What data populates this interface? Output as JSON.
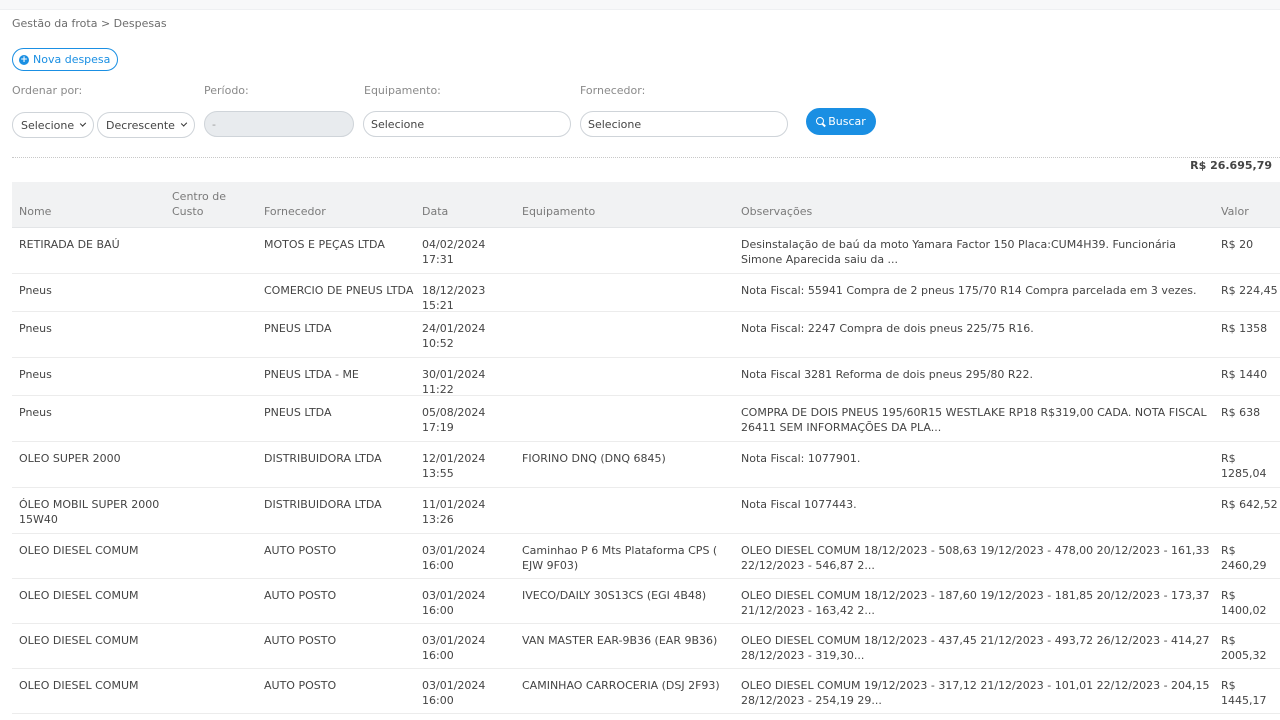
{
  "breadcrumb": "Gestão da frota > Despesas",
  "new_button_label": "Nova despesa",
  "filters": {
    "order_label": "Ordenar por:",
    "period_label": "Período:",
    "equipment_label": "Equipamento:",
    "supplier_label": "Fornecedor:",
    "order_value": "Selecione",
    "direction_value": "Decrescente",
    "period_value": "-",
    "equipment_value": "Selecione",
    "supplier_value": "Selecione",
    "search_label": "Buscar"
  },
  "total": "R$ 26.695,79",
  "columns": [
    "Nome",
    "Centro de Custo",
    "Fornecedor",
    "Data",
    "Equipamento",
    "Observações",
    "Valor"
  ],
  "rows": [
    {
      "nome": "RETIRADA DE BAÚ",
      "centro": "",
      "fornecedor": "MOTOS E PEÇAS LTDA",
      "data": "04/02/2024 17:31",
      "equipamento": "",
      "observacoes": "Desinstalação de baú da moto Yamara Factor 150 Placa:CUM4H39. Funcionária Simone Aparecida saiu da ...",
      "valor": "R$ 20"
    },
    {
      "nome": "Pneus",
      "centro": "",
      "fornecedor": "COMERCIO DE PNEUS LTDA",
      "data": "18/12/2023 15:21",
      "equipamento": "",
      "observacoes": "Nota Fiscal: 55941 Compra de 2 pneus 175/70 R14 Compra parcelada em 3 vezes.",
      "valor": "R$ 224,45"
    },
    {
      "nome": "Pneus",
      "centro": "",
      "fornecedor": "PNEUS LTDA",
      "data": "24/01/2024 10:52",
      "equipamento": "",
      "observacoes": "Nota Fiscal: 2247 Compra de dois pneus 225/75 R16.",
      "valor": "R$ 1358"
    },
    {
      "nome": "Pneus",
      "centro": "",
      "fornecedor": "PNEUS LTDA - ME",
      "data": "30/01/2024 11:22",
      "equipamento": "",
      "observacoes": "Nota Fiscal 3281 Reforma de dois pneus 295/80 R22.",
      "valor": "R$ 1440"
    },
    {
      "nome": "Pneus",
      "centro": "",
      "fornecedor": "PNEUS LTDA",
      "data": "05/08/2024 17:19",
      "equipamento": "",
      "observacoes": "COMPRA DE DOIS PNEUS 195/60R15 WESTLAKE RP18 R$319,00 CADA. NOTA FISCAL 26411 SEM INFORMAÇÕES DA PLA...",
      "valor": "R$ 638"
    },
    {
      "nome": "OLEO SUPER 2000",
      "centro": "",
      "fornecedor": "DISTRIBUIDORA LTDA",
      "data": "12/01/2024 13:55",
      "equipamento": "FIORINO DNQ (DNQ 6845)",
      "observacoes": "Nota Fiscal: 1077901.",
      "valor": "R$ 1285,04"
    },
    {
      "nome": "ÓLEO MOBIL SUPER 2000 15W40",
      "centro": "",
      "fornecedor": "DISTRIBUIDORA LTDA",
      "data": "11/01/2024 13:26",
      "equipamento": "",
      "observacoes": "Nota Fiscal 1077443.",
      "valor": "R$ 642,52"
    },
    {
      "nome": "OLEO DIESEL COMUM",
      "centro": "",
      "fornecedor": "AUTO POSTO",
      "data": "03/01/2024 16:00",
      "equipamento": "Caminhao P 6 Mts Plataforma CPS ( EJW 9F03)",
      "observacoes": "OLEO DIESEL COMUM 18/12/2023 - 508,63 19/12/2023 - 478,00 20/12/2023 - 161,33 22/12/2023 - 546,87 2...",
      "valor": "R$ 2460,29"
    },
    {
      "nome": "OLEO DIESEL COMUM",
      "centro": "",
      "fornecedor": "AUTO POSTO",
      "data": "03/01/2024 16:00",
      "equipamento": "IVECO/DAILY 30S13CS (EGI 4B48)",
      "observacoes": "OLEO DIESEL COMUM 18/12/2023 - 187,60 19/12/2023 - 181,85 20/12/2023 - 173,37 21/12/2023 - 163,42 2...",
      "valor": "R$ 1400,02"
    },
    {
      "nome": "OLEO DIESEL COMUM",
      "centro": "",
      "fornecedor": "AUTO POSTO",
      "data": "03/01/2024 16:00",
      "equipamento": "VAN MASTER EAR-9B36 (EAR 9B36)",
      "observacoes": "OLEO DIESEL COMUM 18/12/2023 - 437,45 21/12/2023 - 493,72 26/12/2023 - 414,27 28/12/2023 - 319,30...",
      "valor": "R$ 2005,32"
    },
    {
      "nome": "OLEO DIESEL COMUM",
      "centro": "",
      "fornecedor": "AUTO POSTO",
      "data": "03/01/2024 16:00",
      "equipamento": "CAMINHAO CARROCERIA (DSJ 2F93)",
      "observacoes": "OLEO DIESEL COMUM 19/12/2023 - 317,12 21/12/2023 - 101,01 22/12/2023 - 204,15 28/12/2023 - 254,19 29...",
      "valor": "R$ 1445,17"
    }
  ]
}
